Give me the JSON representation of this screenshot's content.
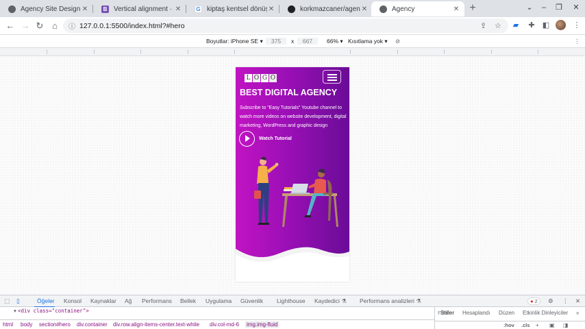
{
  "tabs": [
    {
      "title": "Agency Site Design",
      "icon": "globe-icon"
    },
    {
      "title": "Vertical alignment · Boots",
      "icon": "bootstrap-icon"
    },
    {
      "title": "kiptaş kentsel dönüşüm - ...",
      "icon": "google-icon"
    },
    {
      "title": "korkmazcaner/agency-site",
      "icon": "github-icon"
    },
    {
      "title": "Agency",
      "icon": "globe-icon"
    }
  ],
  "address": {
    "url": "127.0.0.1:5500/index.html?#hero"
  },
  "device_toolbar": {
    "dimensions_label": "Boyutlar: iPhone SE",
    "width": "375",
    "times": "x",
    "height": "667",
    "zoom": "66%",
    "throttle": "Kısıtlama yok"
  },
  "page": {
    "logo_letters": [
      "L",
      "O",
      "G",
      "O"
    ],
    "headline": "BEST DIGITAL AGENCY",
    "description": "Subscribe to \"Easy Tutorials\" Youtube channel to watch more videos on website development, digital marketing, WordPress and graphic design",
    "watch_label": "Watch Tutorial"
  },
  "devtools": {
    "tabs": [
      "Öğeler",
      "Konsol",
      "Kaynaklar",
      "Ağ",
      "Performans",
      "Bellek",
      "Uygulama",
      "Güvenlik",
      "Lighthouse",
      "Kaydedici",
      "Performans analizleri"
    ],
    "error_count": "2",
    "code_line": "<div class=\"container\">",
    "side_tabs": [
      "Stiller",
      "Hesaplandı",
      "Düzen",
      "Etkinlik Dinleyiciler"
    ],
    "filter_placeholder": "Filtre",
    "filter_hov": ":hov",
    "filter_cls": ".cls",
    "breadcrumbs": [
      "html",
      "body",
      "section#hero",
      "div.container",
      "div.row.align-items-center.text-white",
      "div.col-md-6",
      "img.img-fluid"
    ]
  },
  "colors": {
    "hero_start": "#c114c2",
    "hero_end": "#6a0c97",
    "accent": "#1a73e8"
  }
}
